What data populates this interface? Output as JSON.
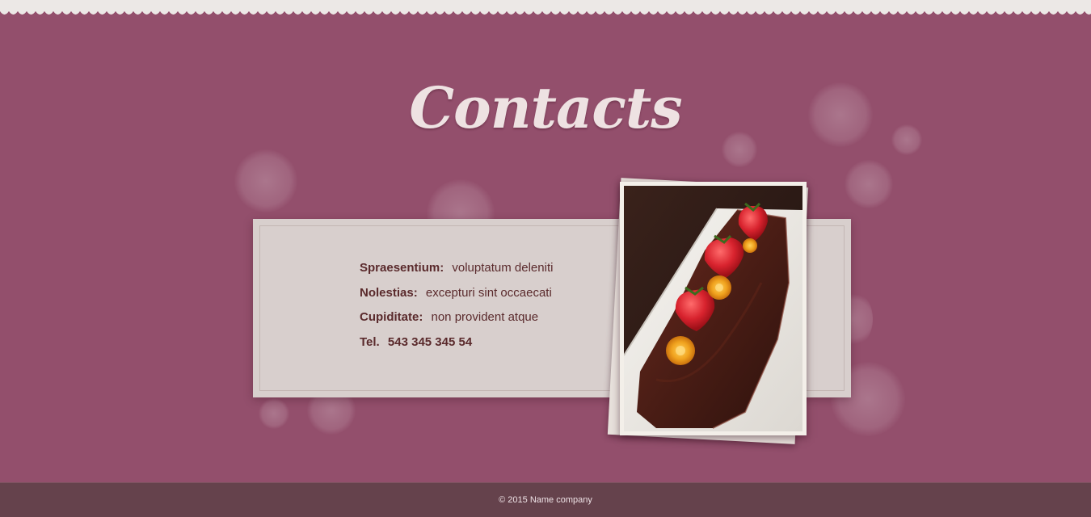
{
  "page": {
    "title": "Contacts"
  },
  "contact": {
    "items": [
      {
        "label": "Spraesentium:",
        "value": "voluptatum deleniti"
      },
      {
        "label": "Nolestias:",
        "value": "excepturi sint occaecati"
      },
      {
        "label": "Cupiditate:",
        "value": "non provident atque"
      }
    ],
    "tel_label": "Tel.",
    "tel_value": "543 345 345 54"
  },
  "footer": {
    "copyright": "© 2015  Name company"
  },
  "colors": {
    "background": "#934f6c",
    "card": "#d8cfcd",
    "text": "#5a2a2c",
    "footer": "#65424c",
    "top_border": "#ece8e6"
  }
}
